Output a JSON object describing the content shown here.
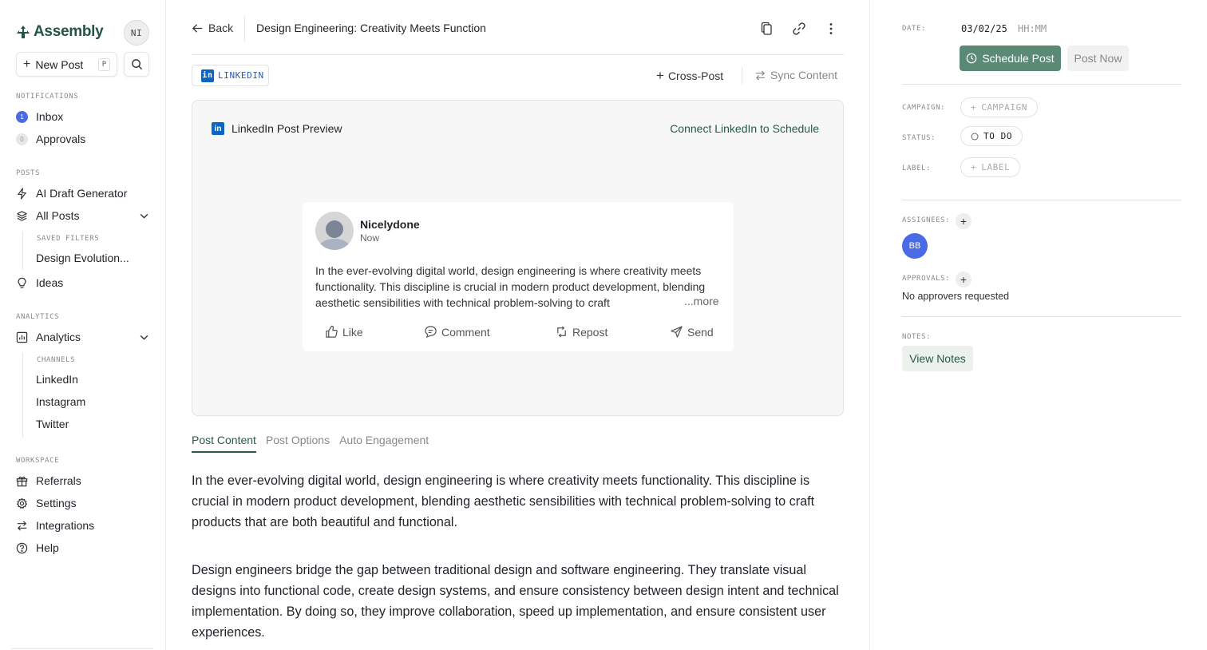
{
  "sidebar": {
    "brand": "Assembly",
    "user_initials": "NI",
    "new_post_label": "New Post",
    "new_post_shortcut": "P",
    "sections": {
      "notifications": "NOTIFICATIONS",
      "posts": "POSTS",
      "analytics": "ANALYTICS",
      "workspace": "WORKSPACE"
    },
    "inbox": {
      "label": "Inbox",
      "count": "1"
    },
    "approvals": {
      "label": "Approvals",
      "count": "0"
    },
    "ai_draft": "AI Draft Generator",
    "all_posts": "All Posts",
    "saved_filters_label": "SAVED FILTERS",
    "saved_filter_item": "Design Evolution...",
    "ideas": "Ideas",
    "analytics": "Analytics",
    "channels_label": "CHANNELS",
    "channels": [
      "LinkedIn",
      "Instagram",
      "Twitter"
    ],
    "workspace_items": [
      "Referrals",
      "Settings",
      "Integrations",
      "Help"
    ]
  },
  "header": {
    "back_label": "Back",
    "title": "Design Engineering: Creativity Meets Function"
  },
  "toolbar": {
    "channel_chip": "LINKEDIN",
    "cross_post": "Cross-Post",
    "sync_content": "Sync Content"
  },
  "preview": {
    "heading": "LinkedIn Post Preview",
    "connect": "Connect LinkedIn to Schedule",
    "author": "Nicelydone",
    "time": "Now",
    "text": "In the ever-evolving digital world, design engineering is where creativity meets functionality. This discipline is crucial in modern product development, blending aesthetic sensibilities with technical problem-solving to craft",
    "more": "...more",
    "actions": {
      "like": "Like",
      "comment": "Comment",
      "repost": "Repost",
      "send": "Send"
    }
  },
  "tabs": [
    "Post Content",
    "Post Options",
    "Auto Engagement"
  ],
  "content": {
    "paragraph1": "In the ever-evolving digital world, design engineering is where creativity meets functionality. This discipline is crucial in modern product development, blending aesthetic sensibilities with technical problem-solving to craft products that are both beautiful and functional.",
    "paragraph2": "Design engineers bridge the gap between traditional design and software engineering. They translate visual designs into functional code, create design systems, and ensure consistency between design intent and technical implementation. By doing so, they improve collaboration, speed up implementation, and ensure consistent user experiences."
  },
  "panel": {
    "date_label": "DATE:",
    "date_value": "03/02/25",
    "time_placeholder": "HH:MM",
    "schedule_label": "Schedule Post",
    "post_now_label": "Post Now",
    "campaign_label": "CAMPAIGN:",
    "campaign_value": "CAMPAIGN",
    "status_label": "STATUS:",
    "status_value": "TO DO",
    "label_label": "LABEL:",
    "label_value": "LABEL",
    "assignees_label": "ASSIGNEES:",
    "assignee_initials": "BB",
    "approvals_label": "APPROVALS:",
    "no_approvers": "No approvers requested",
    "notes_label": "NOTES:",
    "view_notes": "View Notes"
  },
  "colors": {
    "accent": "#235c46",
    "schedule_bg": "#5a8a76",
    "linkedin": "#0a66c2",
    "assignee": "#4a6be3",
    "inbox_badge": "#4a6be3"
  }
}
